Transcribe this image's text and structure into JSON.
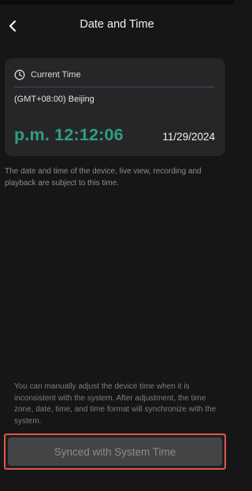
{
  "header": {
    "title": "Date and Time",
    "back_icon": "chevron-left-icon"
  },
  "current_time_card": {
    "heading_icon": "clock-icon",
    "heading_label": "Current Time",
    "timezone": "(GMT+08:00) Beijing",
    "time": "p.m. 12:12:06",
    "date": "11/29/2024",
    "time_color": "#2f9e86"
  },
  "device_note": "The date and time of the device, live view, recording and playback are subject to this time.",
  "adjust_note": "You can manually adjust the device time when it is inconsistent with the system. After adjustment, the time zone, date, time, and time format will synchronize with the system.",
  "sync_button": {
    "label": "Synced with System Time",
    "highlight_color": "#e2554f"
  }
}
